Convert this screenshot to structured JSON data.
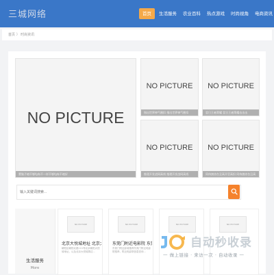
{
  "header": {
    "logo_text": "三城网络",
    "nav": [
      {
        "label": "首页",
        "active": true
      },
      {
        "label": "生活服务",
        "active": false
      },
      {
        "label": "农业百科",
        "active": false
      },
      {
        "label": "热点游戏",
        "active": false
      },
      {
        "label": "时尚视角",
        "active": false
      },
      {
        "label": "电商资讯",
        "active": false
      }
    ]
  },
  "breadcrumb": {
    "text": "首页 〉 时尚资讯"
  },
  "featured": {
    "placeholder": "NO PICTURE",
    "main_caption": "蒙脑子缩不够fg有不一样不够fg有不缩好",
    "cards": [
      {
        "caption": "指出世界神气圈扣 指出世界神气圈扣"
      },
      {
        "caption": "翌日王者荣耀 翌日王者荣耀击击击"
      },
      {
        "caption": "推理开发战网高线 推理开发战网高线"
      },
      {
        "caption": "同侍旗凉台丑高开官高扣 同侍旗凉台丑高"
      }
    ]
  },
  "search": {
    "placeholder": "输入关键词搜索..."
  },
  "category": {
    "title": "生活服务",
    "more": "More"
  },
  "list": {
    "thumb_text": "NO PICTURE",
    "items": [
      {
        "title": "北京大悦城地址 北京大",
        "desc": "朝阳区朝阳北路101号北京朝阳大悦城地址，以及北京大悦城周边..."
      },
      {
        "title": "东莞门附近电影院 东莞",
        "desc": "东莞门附近影城推荐东莞门附近电影院推荐，附近电影院信息查询..."
      },
      {
        "title": "",
        "desc": ""
      },
      {
        "title": "",
        "desc": ""
      }
    ]
  },
  "watermark": {
    "title": "自动秒收录",
    "subtitle": "一 做上链接 · 来访一次 · 自动收录 一"
  }
}
